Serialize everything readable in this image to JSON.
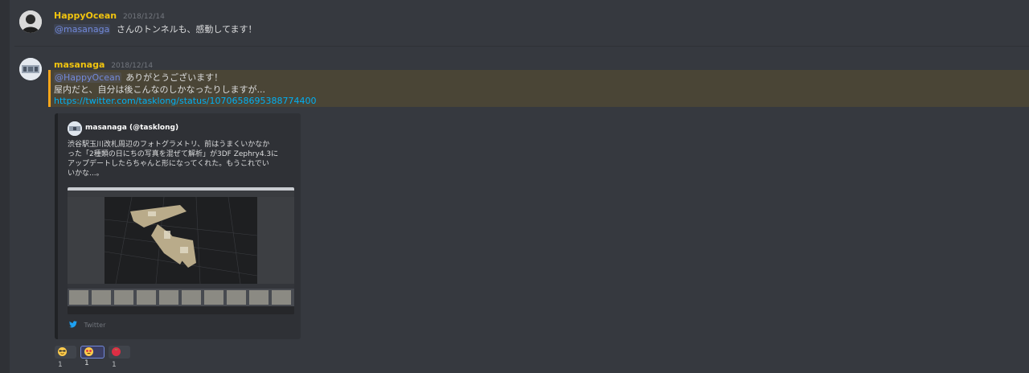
{
  "messages": [
    {
      "author": "HappyOcean",
      "timestamp": "2018/12/14",
      "mention": "@masanaga",
      "text": "さんのトンネルも、感動してます！"
    },
    {
      "author": "masanaga",
      "timestamp": "2018/12/14",
      "mention": "@HappyOcean",
      "line1": "ありがとうございます！",
      "line2": "屋内だと、自分は後こんなのしかなったりしますが...",
      "link": "https://twitter.com/tasklong/status/1070658695388774400"
    }
  ],
  "embed": {
    "author": "masanaga (@tasklong)",
    "description_lines": [
      "渋谷駅玉川改札周辺のフォトグラメトリ、前はうまくいかなか",
      "った「2種類の日にちの写真を混ぜて解析」が3DF Zephry4.3に",
      "アップデートしたらちゃんと形になってくれた。もうこれでい",
      "いかな...。"
    ],
    "footer": "Twitter"
  },
  "reactions": [
    {
      "emoji": "sunglasses-emoji",
      "count": "1",
      "active": false
    },
    {
      "emoji": "heart-eyes-emoji",
      "count": "1",
      "active": true
    },
    {
      "emoji": "tomato-emoji",
      "count": "1",
      "active": false
    }
  ],
  "colors": {
    "background": "#36393f",
    "author_name": "#f1c40f",
    "mention": "#7289da",
    "link": "#00b0f4",
    "highlight_border": "#faa61a",
    "embed_bg": "#2f3136"
  }
}
